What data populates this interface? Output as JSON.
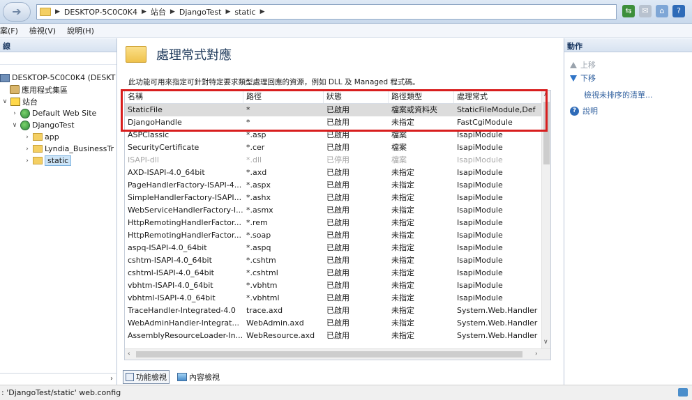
{
  "breadcrumb": [
    "DESKTOP-5C0C0K4",
    "站台",
    "DjangoTest",
    "static"
  ],
  "menu": [
    "案(F)",
    "檢視(V)",
    "說明(H)"
  ],
  "left_panel": {
    "header": "線",
    "tree": [
      {
        "label": "DESKTOP-5C0C0K4 (DESKT",
        "icon": "server-icon"
      },
      {
        "label": "應用程式集區",
        "icon": "app-pool-icon"
      },
      {
        "label": "站台",
        "icon": "sites-icon"
      },
      {
        "label": "Default Web Site",
        "icon": "globe-icon"
      },
      {
        "label": "DjangoTest",
        "icon": "globe-icon"
      },
      {
        "label": "app",
        "icon": "folder-icon"
      },
      {
        "label": "Lyndia_BusinessTr",
        "icon": "folder-icon"
      },
      {
        "label": "static",
        "icon": "folder-icon"
      }
    ]
  },
  "main": {
    "title": "處理常式對應",
    "description": "此功能可用來指定可針對特定要求類型處理回應的資源，例如 DLL 及 Managed 程式碼。",
    "columns": [
      "名稱",
      "路徑",
      "狀態",
      "路徑類型",
      "處理常式"
    ],
    "rows": [
      [
        "StaticFile",
        "*",
        "已啟用",
        "檔案或資料夾",
        "StaticFileModule,Def"
      ],
      [
        "DjangoHandle",
        "*",
        "已啟用",
        "未指定",
        "FastCgiModule"
      ],
      [
        "ASPClassic",
        "*.asp",
        "已啟用",
        "檔案",
        "IsapiModule"
      ],
      [
        "SecurityCertificate",
        "*.cer",
        "已啟用",
        "檔案",
        "IsapiModule"
      ],
      [
        "ISAPI-dll",
        "*.dll",
        "已停用",
        "檔案",
        "IsapiModule"
      ],
      [
        "AXD-ISAPI-4.0_64bit",
        "*.axd",
        "已啟用",
        "未指定",
        "IsapiModule"
      ],
      [
        "PageHandlerFactory-ISAPI-4...",
        "*.aspx",
        "已啟用",
        "未指定",
        "IsapiModule"
      ],
      [
        "SimpleHandlerFactory-ISAPI...",
        "*.ashx",
        "已啟用",
        "未指定",
        "IsapiModule"
      ],
      [
        "WebServiceHandlerFactory-I...",
        "*.asmx",
        "已啟用",
        "未指定",
        "IsapiModule"
      ],
      [
        "HttpRemotingHandlerFactor...",
        "*.rem",
        "已啟用",
        "未指定",
        "IsapiModule"
      ],
      [
        "HttpRemotingHandlerFactor...",
        "*.soap",
        "已啟用",
        "未指定",
        "IsapiModule"
      ],
      [
        "aspq-ISAPI-4.0_64bit",
        "*.aspq",
        "已啟用",
        "未指定",
        "IsapiModule"
      ],
      [
        "cshtm-ISAPI-4.0_64bit",
        "*.cshtm",
        "已啟用",
        "未指定",
        "IsapiModule"
      ],
      [
        "cshtml-ISAPI-4.0_64bit",
        "*.cshtml",
        "已啟用",
        "未指定",
        "IsapiModule"
      ],
      [
        "vbhtm-ISAPI-4.0_64bit",
        "*.vbhtm",
        "已啟用",
        "未指定",
        "IsapiModule"
      ],
      [
        "vbhtml-ISAPI-4.0_64bit",
        "*.vbhtml",
        "已啟用",
        "未指定",
        "IsapiModule"
      ],
      [
        "TraceHandler-Integrated-4.0",
        "trace.axd",
        "已啟用",
        "未指定",
        "System.Web.Handler"
      ],
      [
        "WebAdminHandler-Integrat...",
        "WebAdmin.axd",
        "已啟用",
        "未指定",
        "System.Web.Handler"
      ],
      [
        "AssemblyResourceLoader-In...",
        "WebResource.axd",
        "已啟用",
        "未指定",
        "System.Web.Handler"
      ]
    ],
    "bottom_tabs": [
      "功能檢視",
      "內容檢視"
    ]
  },
  "actions": {
    "header": "動作",
    "move_up": "上移",
    "move_down": "下移",
    "view_unordered": "檢視未排序的清單...",
    "help": "說明"
  },
  "status": ": 'DjangoTest/static' web.config",
  "colors": {
    "highlight_box": "#d81e1e",
    "selected_row": "#dcdcdc"
  }
}
